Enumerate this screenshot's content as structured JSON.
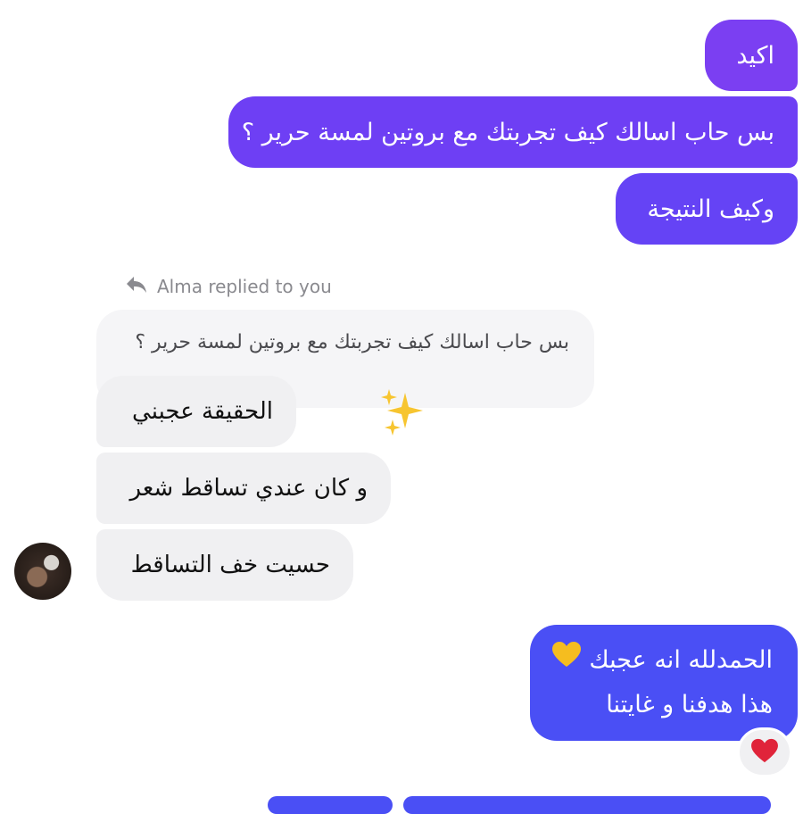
{
  "colors": {
    "outgoing_purple": "#7b3ff2",
    "outgoing_blue": "#4a4ff5",
    "incoming_bg": "#f0f0f2"
  },
  "outgoing_top": [
    {
      "text": "اكيد"
    },
    {
      "text": "بس حاب اسالك كيف تجربتك مع بروتين لمسة حرير ؟"
    },
    {
      "text": "وكيف النتيجة"
    }
  ],
  "reply_banner": {
    "icon": "reply-arrow-icon",
    "label": "Alma replied to you"
  },
  "quoted_message": "بس حاب اسالك كيف تجربتك مع بروتين لمسة حرير ؟",
  "incoming": [
    {
      "text": "الحقيقة عجبني"
    },
    {
      "text": "و كان عندي تساقط شعر"
    },
    {
      "text": "حسيت خف التساقط"
    }
  ],
  "sparkle_reaction": "sparkles-icon",
  "outgoing_last": {
    "line1": "الحمدلله انه عجبك",
    "line1_emoji": "yellow-heart-icon",
    "line2": "هذا هدفنا و غايتنا",
    "reaction": "red-heart-icon"
  }
}
